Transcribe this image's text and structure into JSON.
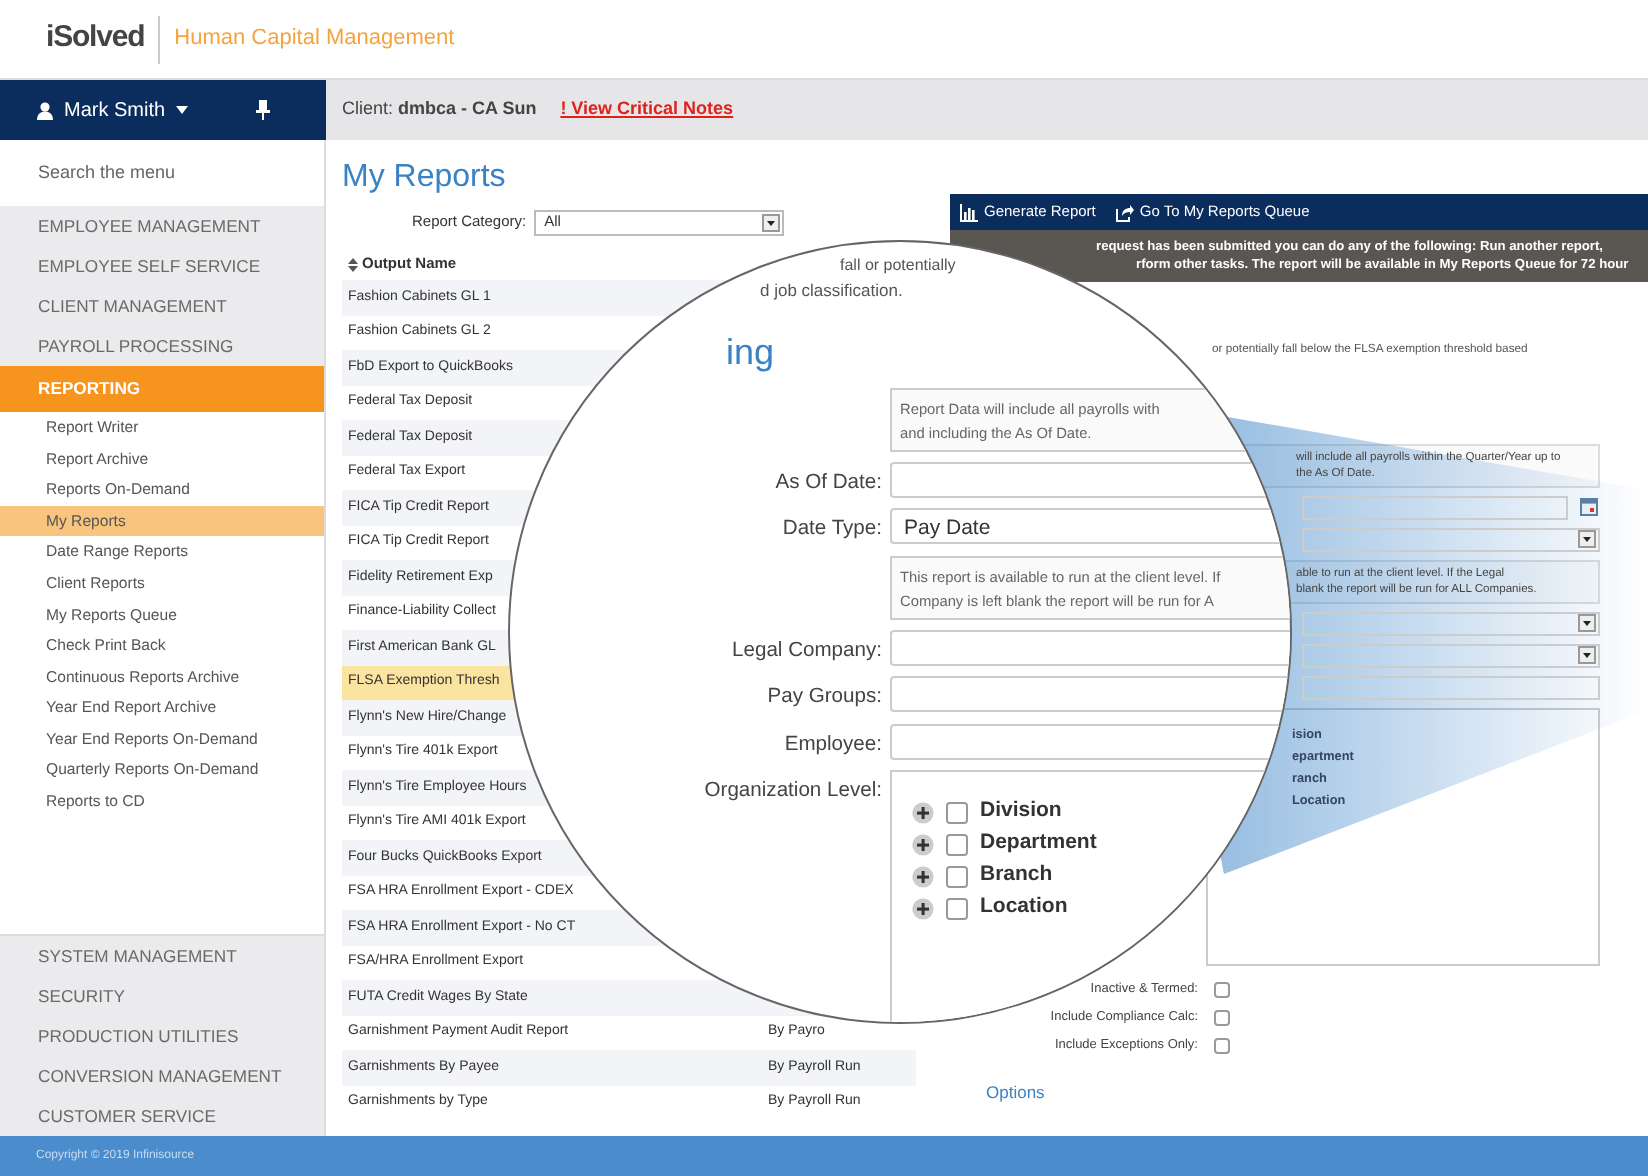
{
  "header": {
    "logo": "iSolved",
    "product": "Human Capital Management"
  },
  "user": {
    "name": "Mark Smith"
  },
  "client_bar": {
    "label": "Client:",
    "client": "dmbca - CA Sun",
    "alert": "! View Critical Notes"
  },
  "sidebar": {
    "search_placeholder": "Search the menu",
    "sections": [
      {
        "label": "EMPLOYEE MANAGEMENT",
        "selected": false
      },
      {
        "label": "EMPLOYEE SELF SERVICE",
        "selected": false
      },
      {
        "label": "CLIENT MANAGEMENT",
        "selected": false
      },
      {
        "label": "PAYROLL PROCESSING",
        "selected": false
      },
      {
        "label": "REPORTING",
        "selected": true,
        "items": [
          {
            "label": "Report Writer",
            "selected": false
          },
          {
            "label": "Report Archive",
            "selected": false
          },
          {
            "label": "Reports On-Demand",
            "selected": false
          },
          {
            "label": "My Reports",
            "selected": true
          },
          {
            "label": "Date Range Reports",
            "selected": false
          },
          {
            "label": "Client Reports",
            "selected": false
          },
          {
            "label": "My Reports Queue",
            "selected": false
          },
          {
            "label": "Check Print Back",
            "selected": false
          },
          {
            "label": "Continuous Reports Archive",
            "selected": false
          },
          {
            "label": "Year End Report Archive",
            "selected": false
          },
          {
            "label": "Year End Reports On-Demand",
            "selected": false
          },
          {
            "label": "Quarterly Reports On-Demand",
            "selected": false
          },
          {
            "label": "Reports to CD",
            "selected": false
          }
        ]
      },
      {
        "label": "SYSTEM MANAGEMENT",
        "selected": false
      },
      {
        "label": "SECURITY",
        "selected": false
      },
      {
        "label": "PRODUCTION UTILITIES",
        "selected": false
      },
      {
        "label": "CONVERSION MANAGEMENT",
        "selected": false
      },
      {
        "label": "CUSTOMER SERVICE",
        "selected": false
      }
    ]
  },
  "footer": "Copyright © 2019 Infinisource",
  "page_title": "My Reports",
  "report_category": {
    "label": "Report Category:",
    "value": "All"
  },
  "report_list": {
    "column": "Output Name",
    "rows": [
      {
        "name": "Fashion Cabinets GL 1",
        "selected": false
      },
      {
        "name": "Fashion Cabinets GL 2",
        "selected": false
      },
      {
        "name": "FbD Export to QuickBooks",
        "selected": false
      },
      {
        "name": "Federal Tax Deposit",
        "selected": false
      },
      {
        "name": "Federal Tax Deposit",
        "selected": false
      },
      {
        "name": "Federal Tax Export",
        "selected": false
      },
      {
        "name": "FICA Tip Credit Report",
        "selected": false
      },
      {
        "name": "FICA Tip Credit Report",
        "selected": false
      },
      {
        "name": "Fidelity Retirement Exp",
        "selected": false
      },
      {
        "name": "Finance-Liability Collect",
        "selected": false
      },
      {
        "name": "First American Bank GL",
        "selected": false
      },
      {
        "name": "FLSA Exemption Thresh",
        "selected": true
      },
      {
        "name": "Flynn's New Hire/Change",
        "selected": false
      },
      {
        "name": "Flynn's Tire 401k Export",
        "selected": false
      },
      {
        "name": "Flynn's Tire Employee Hours",
        "selected": false
      },
      {
        "name": "Flynn's Tire AMI 401k Export",
        "selected": false
      },
      {
        "name": "Four Bucks QuickBooks Export",
        "selected": false
      },
      {
        "name": "FSA HRA Enrollment Export - CDEX",
        "selected": false
      },
      {
        "name": "FSA HRA Enrollment Export - No CT",
        "selected": false
      },
      {
        "name": "FSA/HRA Enrollment Export",
        "selected": false
      },
      {
        "name": "FUTA Credit Wages By State",
        "selected": false
      },
      {
        "name": "Garnishment Payment Audit Report",
        "run_type": "By Payro",
        "selected": false
      },
      {
        "name": "Garnishments By Payee",
        "run_type": "By Payroll Run",
        "selected": false
      },
      {
        "name": "Garnishments by Type",
        "run_type": "By Payroll Run",
        "selected": false
      }
    ]
  },
  "toolbar": [
    {
      "label": "Generate Report",
      "kind": "chart"
    },
    {
      "label": "Go To My Reports Queue",
      "kind": "queue"
    }
  ],
  "notice": [
    "request has been submitted you can do any of the following: Run another report,",
    "rform other tasks. The report will be available in My Reports Queue for 72 hour"
  ],
  "form": {
    "rows": [
      {
        "kind": "text",
        "text": "or potentially fall below the FLSA exemption threshold based"
      },
      {
        "kind": "help",
        "lines": [
          "will include all payrolls within the Quarter/Year up to",
          "the As Of Date."
        ]
      },
      {
        "kind": "date"
      },
      {
        "kind": "select"
      },
      {
        "kind": "help",
        "lines": [
          "able to run at the client level. If the Legal",
          "blank the report will be run for ALL Companies."
        ]
      },
      {
        "kind": "select"
      },
      {
        "kind": "select"
      },
      {
        "kind": "input"
      },
      {
        "kind": "tree",
        "nodes": [
          "ision",
          "epartment",
          "ranch",
          "Location"
        ]
      },
      {
        "kind": "checkbox",
        "label": "Inactive & Termed:",
        "checked": false
      },
      {
        "kind": "checkbox",
        "label": "Include Compliance Calc:",
        "checked": false
      },
      {
        "kind": "checkbox",
        "label": "Include Exceptions Only:",
        "checked": false
      }
    ],
    "options": "Options"
  },
  "magnifier": {
    "lines": [
      "fall or potentially",
      "d job classification."
    ],
    "heading": "ing",
    "rows": [
      {
        "kind": "help",
        "lines": [
          "Report Data will include all payrolls with",
          "and including the As Of Date."
        ]
      },
      {
        "kind": "input",
        "label": "As Of Date:"
      },
      {
        "kind": "select",
        "label": "Date Type:",
        "value": "Pay Date"
      },
      {
        "kind": "help",
        "lines": [
          "This report is available to run at the client level. If",
          "Company is left blank the report will be run for A"
        ]
      },
      {
        "kind": "input",
        "label": "Legal Company:"
      },
      {
        "kind": "input",
        "label": "Pay Groups:"
      },
      {
        "kind": "input",
        "label": "Employee:"
      },
      {
        "kind": "tree",
        "label": "Organization Level:",
        "nodes": [
          {
            "label": "Division",
            "checked": false,
            "expanded": false
          },
          {
            "label": "Department",
            "checked": false,
            "expanded": false
          },
          {
            "label": "Branch",
            "checked": false,
            "expanded": false
          },
          {
            "label": "Location",
            "checked": false,
            "expanded": false
          }
        ]
      }
    ]
  }
}
